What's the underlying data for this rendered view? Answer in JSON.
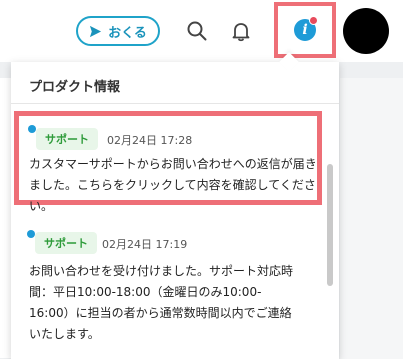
{
  "header": {
    "send_button_label": "おくる"
  },
  "panel": {
    "title": "プロダクト情報",
    "items": [
      {
        "badge": "サポート",
        "date": "02月24日 17:28",
        "message_lines": [
          "カスタマーサポートからお問い合わせへの返信が届き",
          "ました。こちらをクリックして内容を確認してください。"
        ]
      },
      {
        "badge": "サポート",
        "date": "02月24日 17:19",
        "message_lines": [
          "お問い合わせを受け付けました。サポート対応時",
          "間：平日10:00-18:00（金曜日のみ10:00-",
          "16:00）に担当の者から通常数時間以内でご連絡",
          "いたします。"
        ]
      }
    ]
  },
  "colors": {
    "accent": "#1e9bd7",
    "highlight_border": "#ee6f77",
    "badge_bg": "#e8f6e9",
    "badge_text": "#2e9b3a",
    "notification_dot": "#e84b5c"
  }
}
